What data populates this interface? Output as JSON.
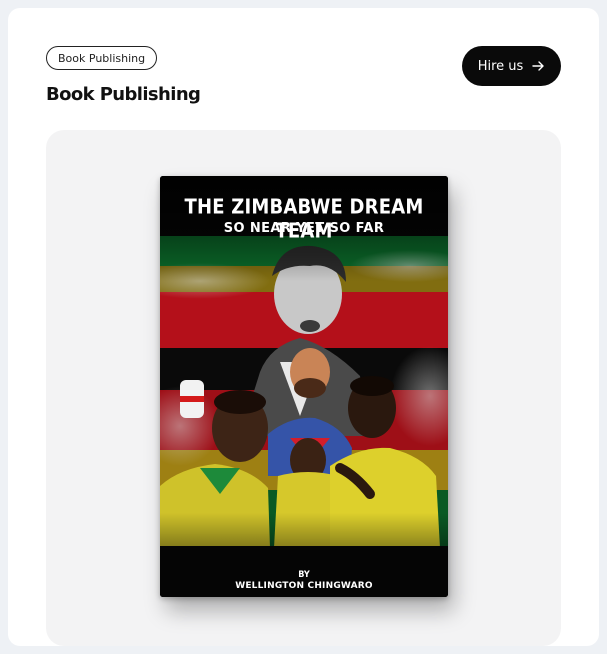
{
  "project": {
    "tag": "Book Publishing",
    "title": "Book Publishing",
    "cta_label": "Hire us",
    "cta_icon": "arrow-right-icon"
  },
  "book": {
    "title": "THE ZIMBABWE DREAM TEAM",
    "subtitle": "SO NEAR YET SO FAR",
    "by": "BY",
    "author": "WELLINGTON CHINGWARO"
  },
  "colors": {
    "card_bg": "#ffffff",
    "page_bg": "#eef1f5",
    "preview_bg": "#f3f3f4",
    "button_bg": "#0a0a0a",
    "flag_green": "#0b6b2a",
    "flag_yellow": "#e8c21a",
    "flag_red": "#b4101a"
  }
}
